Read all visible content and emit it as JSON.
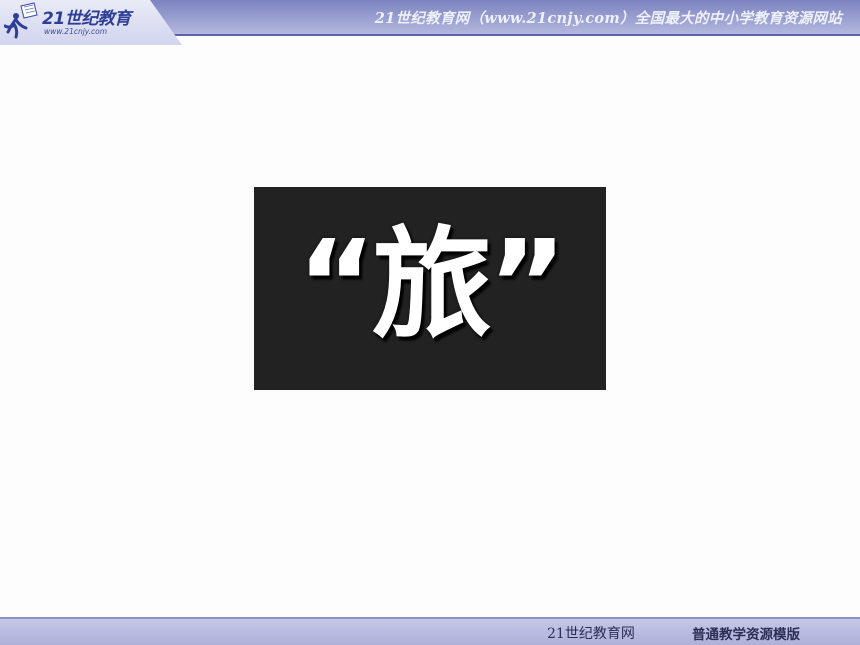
{
  "header": {
    "logo": {
      "icon": "running-figure-book-icon",
      "name": "21世纪教育",
      "url": "www.21cnjy.com"
    },
    "slogan": "21世纪教育网（www.21cnjy.com）全国最大的中小学教育资源网站"
  },
  "main": {
    "title": "“旅”"
  },
  "footer": {
    "site_name": "21世纪教育网",
    "template_name": "普通教学资源模版"
  },
  "colors": {
    "header_band": "#9aa0d0",
    "card_background": "#222222",
    "title_text": "#ffffff",
    "footer_band": "#b4b8de"
  }
}
